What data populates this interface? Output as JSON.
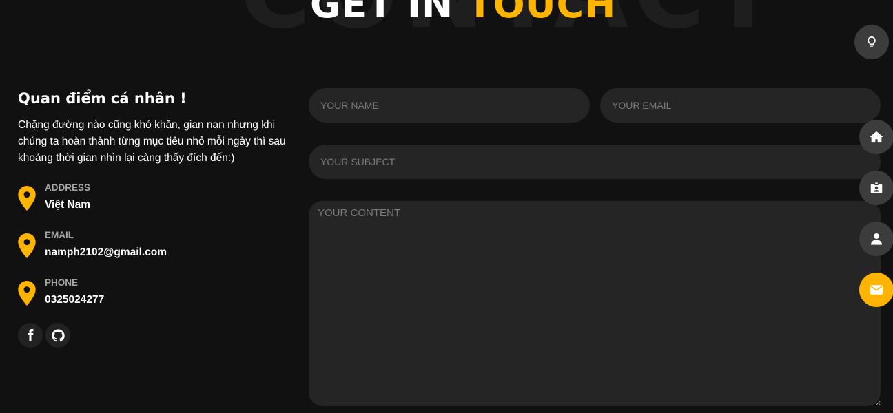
{
  "heading": {
    "background_word": "CONTACT",
    "title_part1": "GET IN",
    "title_part2": "TOUCH"
  },
  "intro": {
    "title": "Quan điểm cá nhân !",
    "text": "Chặng đường nào cũng khó khăn, gian nan nhưng khi chúng ta hoàn thành từng mục tiêu nhỏ mỗi ngày thì sau khoảng thời gian nhìn lại càng thấy đích đến:)"
  },
  "contact_items": [
    {
      "label": "ADDRESS",
      "value": "Việt Nam",
      "icon": "map-pin-icon"
    },
    {
      "label": "EMAIL",
      "value": "namph2102@gmail.com",
      "icon": "map-pin-icon"
    },
    {
      "label": "PHONE",
      "value": "0325024277",
      "icon": "map-pin-icon"
    }
  ],
  "social": [
    {
      "icon": "facebook-icon"
    },
    {
      "icon": "github-icon"
    }
  ],
  "form": {
    "name_placeholder": "YOUR NAME",
    "email_placeholder": "YOUR EMAIL",
    "subject_placeholder": "YOUR SUBJECT",
    "content_placeholder": "YOUR CONTENT"
  },
  "nav": [
    {
      "icon": "lightbulb-icon",
      "active": false
    },
    {
      "icon": "home-icon",
      "active": false
    },
    {
      "icon": "id-card-icon",
      "active": false
    },
    {
      "icon": "user-icon",
      "active": false
    },
    {
      "icon": "envelope-icon",
      "active": true
    }
  ],
  "colors": {
    "background": "#111111",
    "accent": "#ffb400",
    "field": "#252525",
    "nav_button": "#3c3c3c"
  }
}
